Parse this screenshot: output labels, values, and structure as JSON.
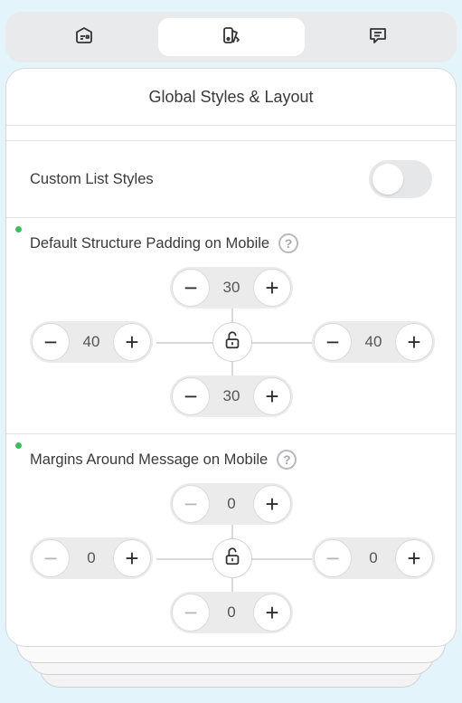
{
  "tabs": [
    {
      "name": "tab-content",
      "icon": "card-icon"
    },
    {
      "name": "tab-styles",
      "icon": "paint-bucket-icon",
      "active": true
    },
    {
      "name": "tab-messages",
      "icon": "chat-icon"
    }
  ],
  "panel": {
    "title": "Global Styles & Layout"
  },
  "custom_list_styles": {
    "label": "Custom List Styles",
    "enabled": false
  },
  "padding_mobile": {
    "label": "Default Structure Padding on Mobile",
    "help": "?",
    "top": "30",
    "left": "40",
    "right": "40",
    "bottom": "30"
  },
  "margins_mobile": {
    "label": "Margins Around Message on Mobile",
    "help": "?",
    "top": "0",
    "left": "0",
    "right": "0",
    "bottom": "0"
  },
  "colors": {
    "background": "#e4f4fb",
    "changed_dot": "#35c25a"
  }
}
